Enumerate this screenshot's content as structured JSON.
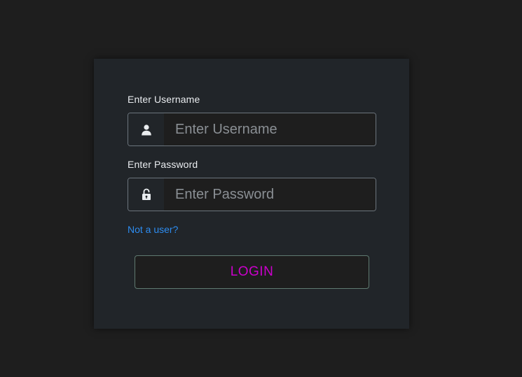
{
  "form": {
    "username_label": "Enter Username",
    "username_placeholder": "Enter Username",
    "username_value": "",
    "username_icon": "user-icon",
    "password_label": "Enter Password",
    "password_placeholder": "Enter Password",
    "password_value": "",
    "password_icon": "unlock-icon",
    "register_link": "Not a user?",
    "login_label": "LOGIN"
  },
  "colors": {
    "background": "#1e1e1e",
    "card": "#212529",
    "link": "#2d8cf0",
    "login_text": "#cc00cc",
    "login_border": "#5f7a70"
  }
}
